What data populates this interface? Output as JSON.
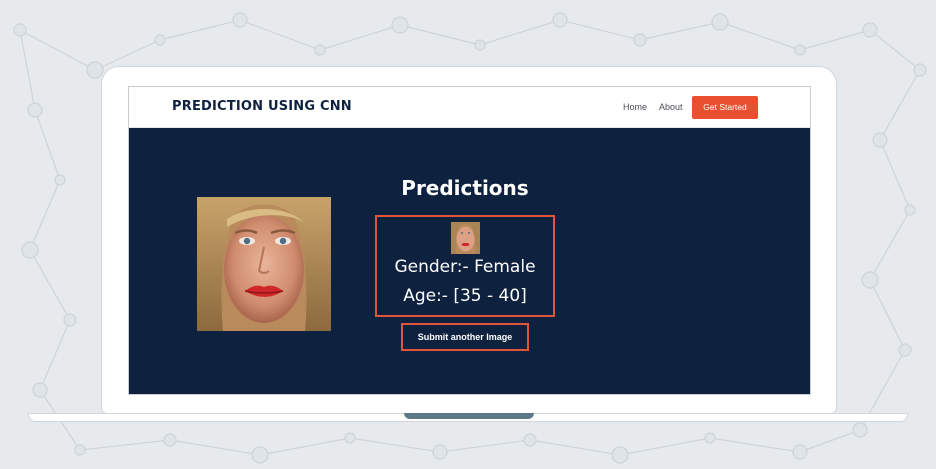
{
  "navbar": {
    "brand": "PREDICTION USING CNN",
    "links": [
      "Home",
      "About"
    ],
    "cta": "Get Started"
  },
  "main": {
    "title": "Predictions",
    "gender_text": "Gender:- Female",
    "age_text": "Age:- [35 - 40]",
    "submit_label": "Submit another Image"
  },
  "colors": {
    "screen_bg": "#0e2240",
    "accent": "#e8502f",
    "background": "#e6eaed"
  }
}
